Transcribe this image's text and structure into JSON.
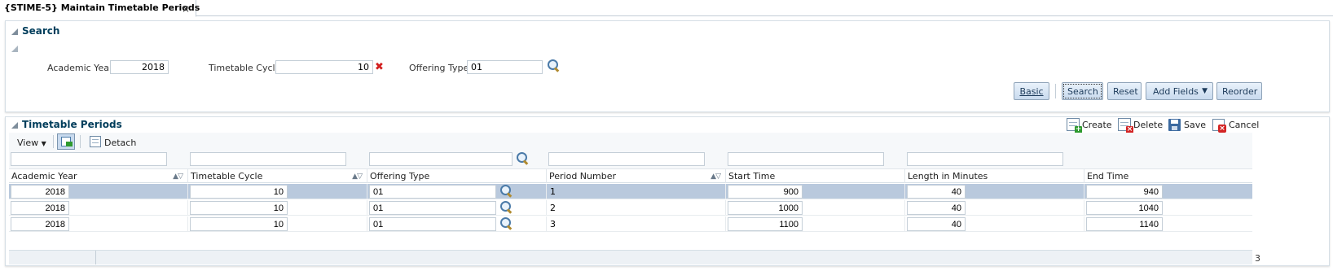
{
  "tab": {
    "title": "{STIME-5} Maintain Timetable Periods",
    "close": "×"
  },
  "search": {
    "title": "Search",
    "fields": {
      "academic_year": {
        "label": "Academic Year",
        "value": "2018"
      },
      "timetable_cycle": {
        "label": "Timetable Cycle",
        "value": "10"
      },
      "offering_type": {
        "label": "Offering Type",
        "value": "01"
      }
    },
    "buttons": {
      "basic": "Basic",
      "search": "Search",
      "reset": "Reset",
      "add_fields": "Add Fields",
      "reorder": "Reorder"
    }
  },
  "results": {
    "title": "Timetable Periods",
    "toolbar": {
      "create": "Create",
      "delete": "Delete",
      "save": "Save",
      "cancel": "Cancel",
      "view": "View",
      "detach": "Detach"
    },
    "columns": [
      "Academic Year",
      "Timetable Cycle",
      "Offering Type",
      "Period Number",
      "Start Time",
      "Length in Minutes",
      "End Time"
    ],
    "rows": [
      {
        "academic_year": "2018",
        "timetable_cycle": "10",
        "offering_type": "01",
        "period_number": "1",
        "start_time": "900",
        "length": "40",
        "end_time": "940"
      },
      {
        "academic_year": "2018",
        "timetable_cycle": "10",
        "offering_type": "01",
        "period_number": "2",
        "start_time": "1000",
        "length": "40",
        "end_time": "1040"
      },
      {
        "academic_year": "2018",
        "timetable_cycle": "10",
        "offering_type": "01",
        "period_number": "3",
        "start_time": "1100",
        "length": "40",
        "end_time": "1140"
      }
    ],
    "row_count": "3"
  },
  "colors": {
    "title": "#003d5b",
    "selected_row": "#b9c9dd",
    "button_gradient_top": "#e9f2fb",
    "button_gradient_bottom": "#c9daee"
  }
}
